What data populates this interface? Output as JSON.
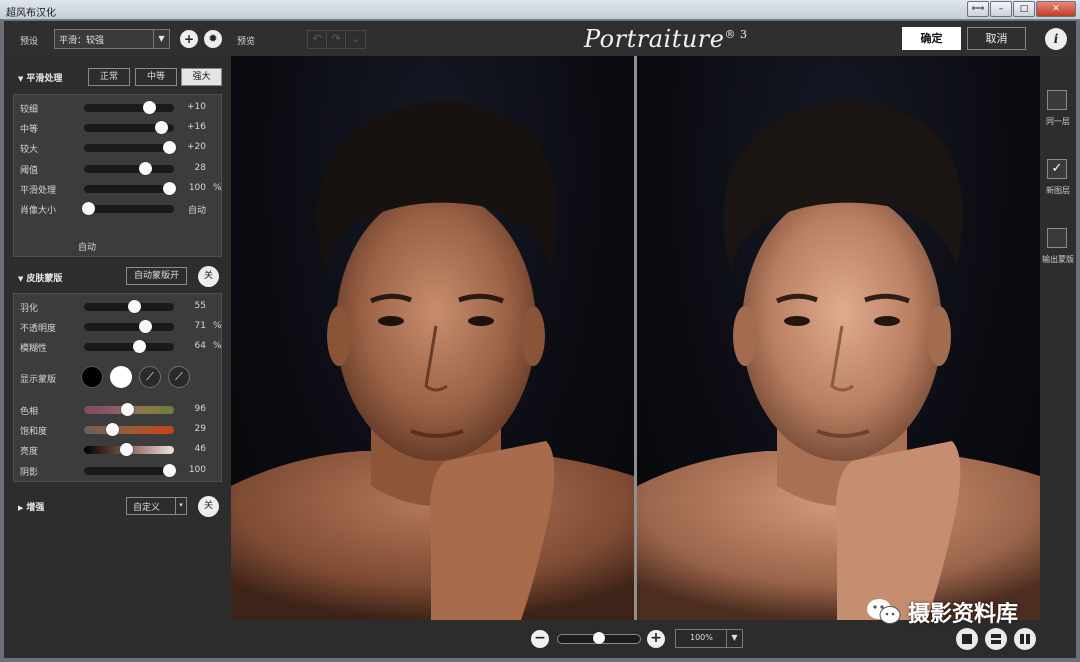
{
  "window": {
    "title": "超风布汉化",
    "buttons": [
      "⟺",
      "–",
      "□",
      "✕"
    ]
  },
  "topbar": {
    "preset_label": "预设",
    "preset_value": "平滑：较强",
    "add_icon": "plus-icon",
    "settings_icon": "gear-icon",
    "preview_label": "预览",
    "logo": "Portraiture",
    "logo_mark": "® 3",
    "ok_label": "确定",
    "cancel_label": "取消",
    "info_label": "i"
  },
  "smoothing": {
    "title": "平滑处理",
    "modes": [
      "正常",
      "中等",
      "强大"
    ],
    "active_mode": "强大",
    "sliders": [
      {
        "label": "较细",
        "value": "+10",
        "unit": "",
        "level": 0.72
      },
      {
        "label": "中等",
        "value": "+16",
        "unit": "",
        "level": 0.86
      },
      {
        "label": "较大",
        "value": "+20",
        "unit": "",
        "level": 0.94
      },
      {
        "label": "阈值",
        "value": "28",
        "unit": "",
        "level": 0.68
      },
      {
        "label": "平滑处理",
        "value": "100",
        "unit": "%",
        "level": 0.94
      },
      {
        "label": "肖像大小",
        "value": "自动",
        "unit": "",
        "level": 0.04
      }
    ],
    "portrait_size_note": "自动"
  },
  "skin_mask": {
    "title": "皮肤蒙版",
    "auto_button": "自动蒙版开",
    "toggle": "关",
    "sliders": [
      {
        "label": "羽化",
        "value": "55",
        "unit": "",
        "level": 0.55
      },
      {
        "label": "不透明度",
        "value": "71",
        "unit": "%",
        "level": 0.68
      },
      {
        "label": "模糊性",
        "value": "64",
        "unit": "%",
        "level": 0.61
      }
    ],
    "show_mask_label": "显示蒙版",
    "color_sliders": [
      {
        "label": "色相",
        "value": "96",
        "unit": "",
        "level": 0.48
      },
      {
        "label": "饱和度",
        "value": "29",
        "unit": "",
        "level": 0.31
      },
      {
        "label": "亮度",
        "value": "46",
        "unit": "",
        "level": 0.47
      },
      {
        "label": "阴影",
        "value": "100",
        "unit": "",
        "level": 0.94
      }
    ]
  },
  "enhance": {
    "title": "增强",
    "preset": "自定义",
    "toggle": "关"
  },
  "right_panel": {
    "items": [
      {
        "label": "同一层",
        "checked": false
      },
      {
        "label": "新图层",
        "checked": true
      },
      {
        "label": "输出蒙版",
        "checked": false
      }
    ]
  },
  "bottombar": {
    "zoom_out": "−",
    "zoom_in": "+",
    "zoom_level": 0.5,
    "zoom_value": "100%"
  },
  "watermark": {
    "text": "摄影资料库"
  },
  "colors": {
    "panel": "#2d2d2d",
    "group": "#3c3c3c",
    "accent": "#ffffff"
  }
}
